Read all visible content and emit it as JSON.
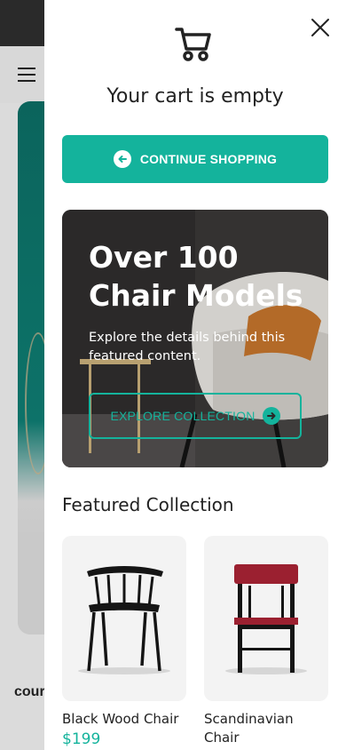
{
  "background_page": {
    "partial_text": "cour"
  },
  "cart": {
    "empty_title": "Your cart is empty",
    "continue_label": "CONTINUE SHOPPING",
    "accent_color": "#14b39c"
  },
  "promo": {
    "headline": "Over 100 Chair Models",
    "subtext": "Explore the details behind this featured content.",
    "button_label": "EXPLORE COLLECTION"
  },
  "featured": {
    "title": "Featured Collection",
    "products": [
      {
        "name": "Black Wood Chair",
        "price": "$199",
        "icon": "black-wood-chair-image"
      },
      {
        "name": "Scandinavian Chair",
        "price": "",
        "icon": "scandinavian-chair-image"
      }
    ]
  },
  "icons": {
    "close": "close-icon",
    "cart": "cart-icon",
    "menu": "menu-icon",
    "arrow_left": "arrow-left-icon",
    "arrow_right": "arrow-right-icon"
  }
}
